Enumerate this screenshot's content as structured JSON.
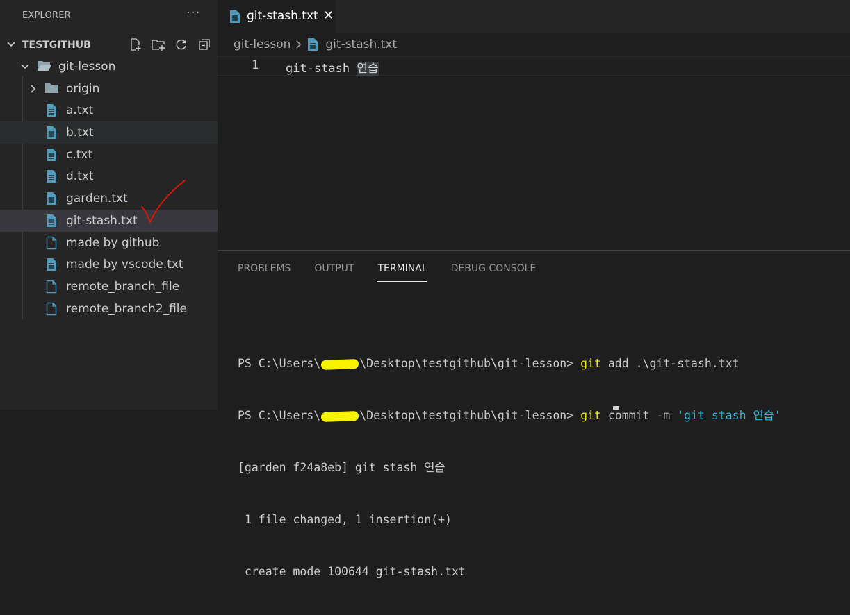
{
  "explorer": {
    "title": "EXPLORER",
    "more_icon": "ellipsis-icon",
    "folder_name": "TESTGITHUB",
    "actions": [
      "new-file-icon",
      "new-folder-icon",
      "refresh-icon",
      "collapse-all-icon"
    ],
    "tree": [
      {
        "label": "git-lesson",
        "type": "folder",
        "expanded": true
      },
      {
        "label": "origin",
        "type": "folder",
        "expanded": false
      },
      {
        "label": "a.txt",
        "type": "file"
      },
      {
        "label": "b.txt",
        "type": "file",
        "state": "hover"
      },
      {
        "label": "c.txt",
        "type": "file"
      },
      {
        "label": "d.txt",
        "type": "file"
      },
      {
        "label": "garden.txt",
        "type": "file"
      },
      {
        "label": "git-stash.txt",
        "type": "file",
        "state": "selected"
      },
      {
        "label": "made by github",
        "type": "file-outline"
      },
      {
        "label": "made by vscode.txt",
        "type": "file"
      },
      {
        "label": "remote_branch_file",
        "type": "file-outline"
      },
      {
        "label": "remote_branch2_file",
        "type": "file-outline"
      }
    ]
  },
  "editor": {
    "tab_title": "git-stash.txt",
    "breadcrumb": {
      "folder": "git-lesson",
      "file": "git-stash.txt"
    },
    "line_number": "1",
    "line_text": "git-stash ",
    "line_text_hl": "연습"
  },
  "panel": {
    "tabs": [
      "PROBLEMS",
      "OUTPUT",
      "TERMINAL",
      "DEBUG CONSOLE"
    ],
    "active_tab": "TERMINAL"
  },
  "terminal": {
    "prompt_pre": "PS C:\\Users\\",
    "prompt_post": "\\Desktop\\testgithub\\git-lesson> ",
    "line1_cmd": "git",
    "line1_args": " add .\\git-stash.txt",
    "line2_cmd": "git",
    "line2_args": " commit ",
    "line2_flag": "-m",
    "line2_str": " 'git stash 연습'",
    "line3": "[garden f24a8eb] git stash 연습",
    "line4": " 1 file changed, 1 insertion(+)",
    "line5": " create mode 100644 git-stash.txt"
  },
  "colors": {
    "accent_file_icon": "#519aba",
    "annotation": "#e51400"
  }
}
